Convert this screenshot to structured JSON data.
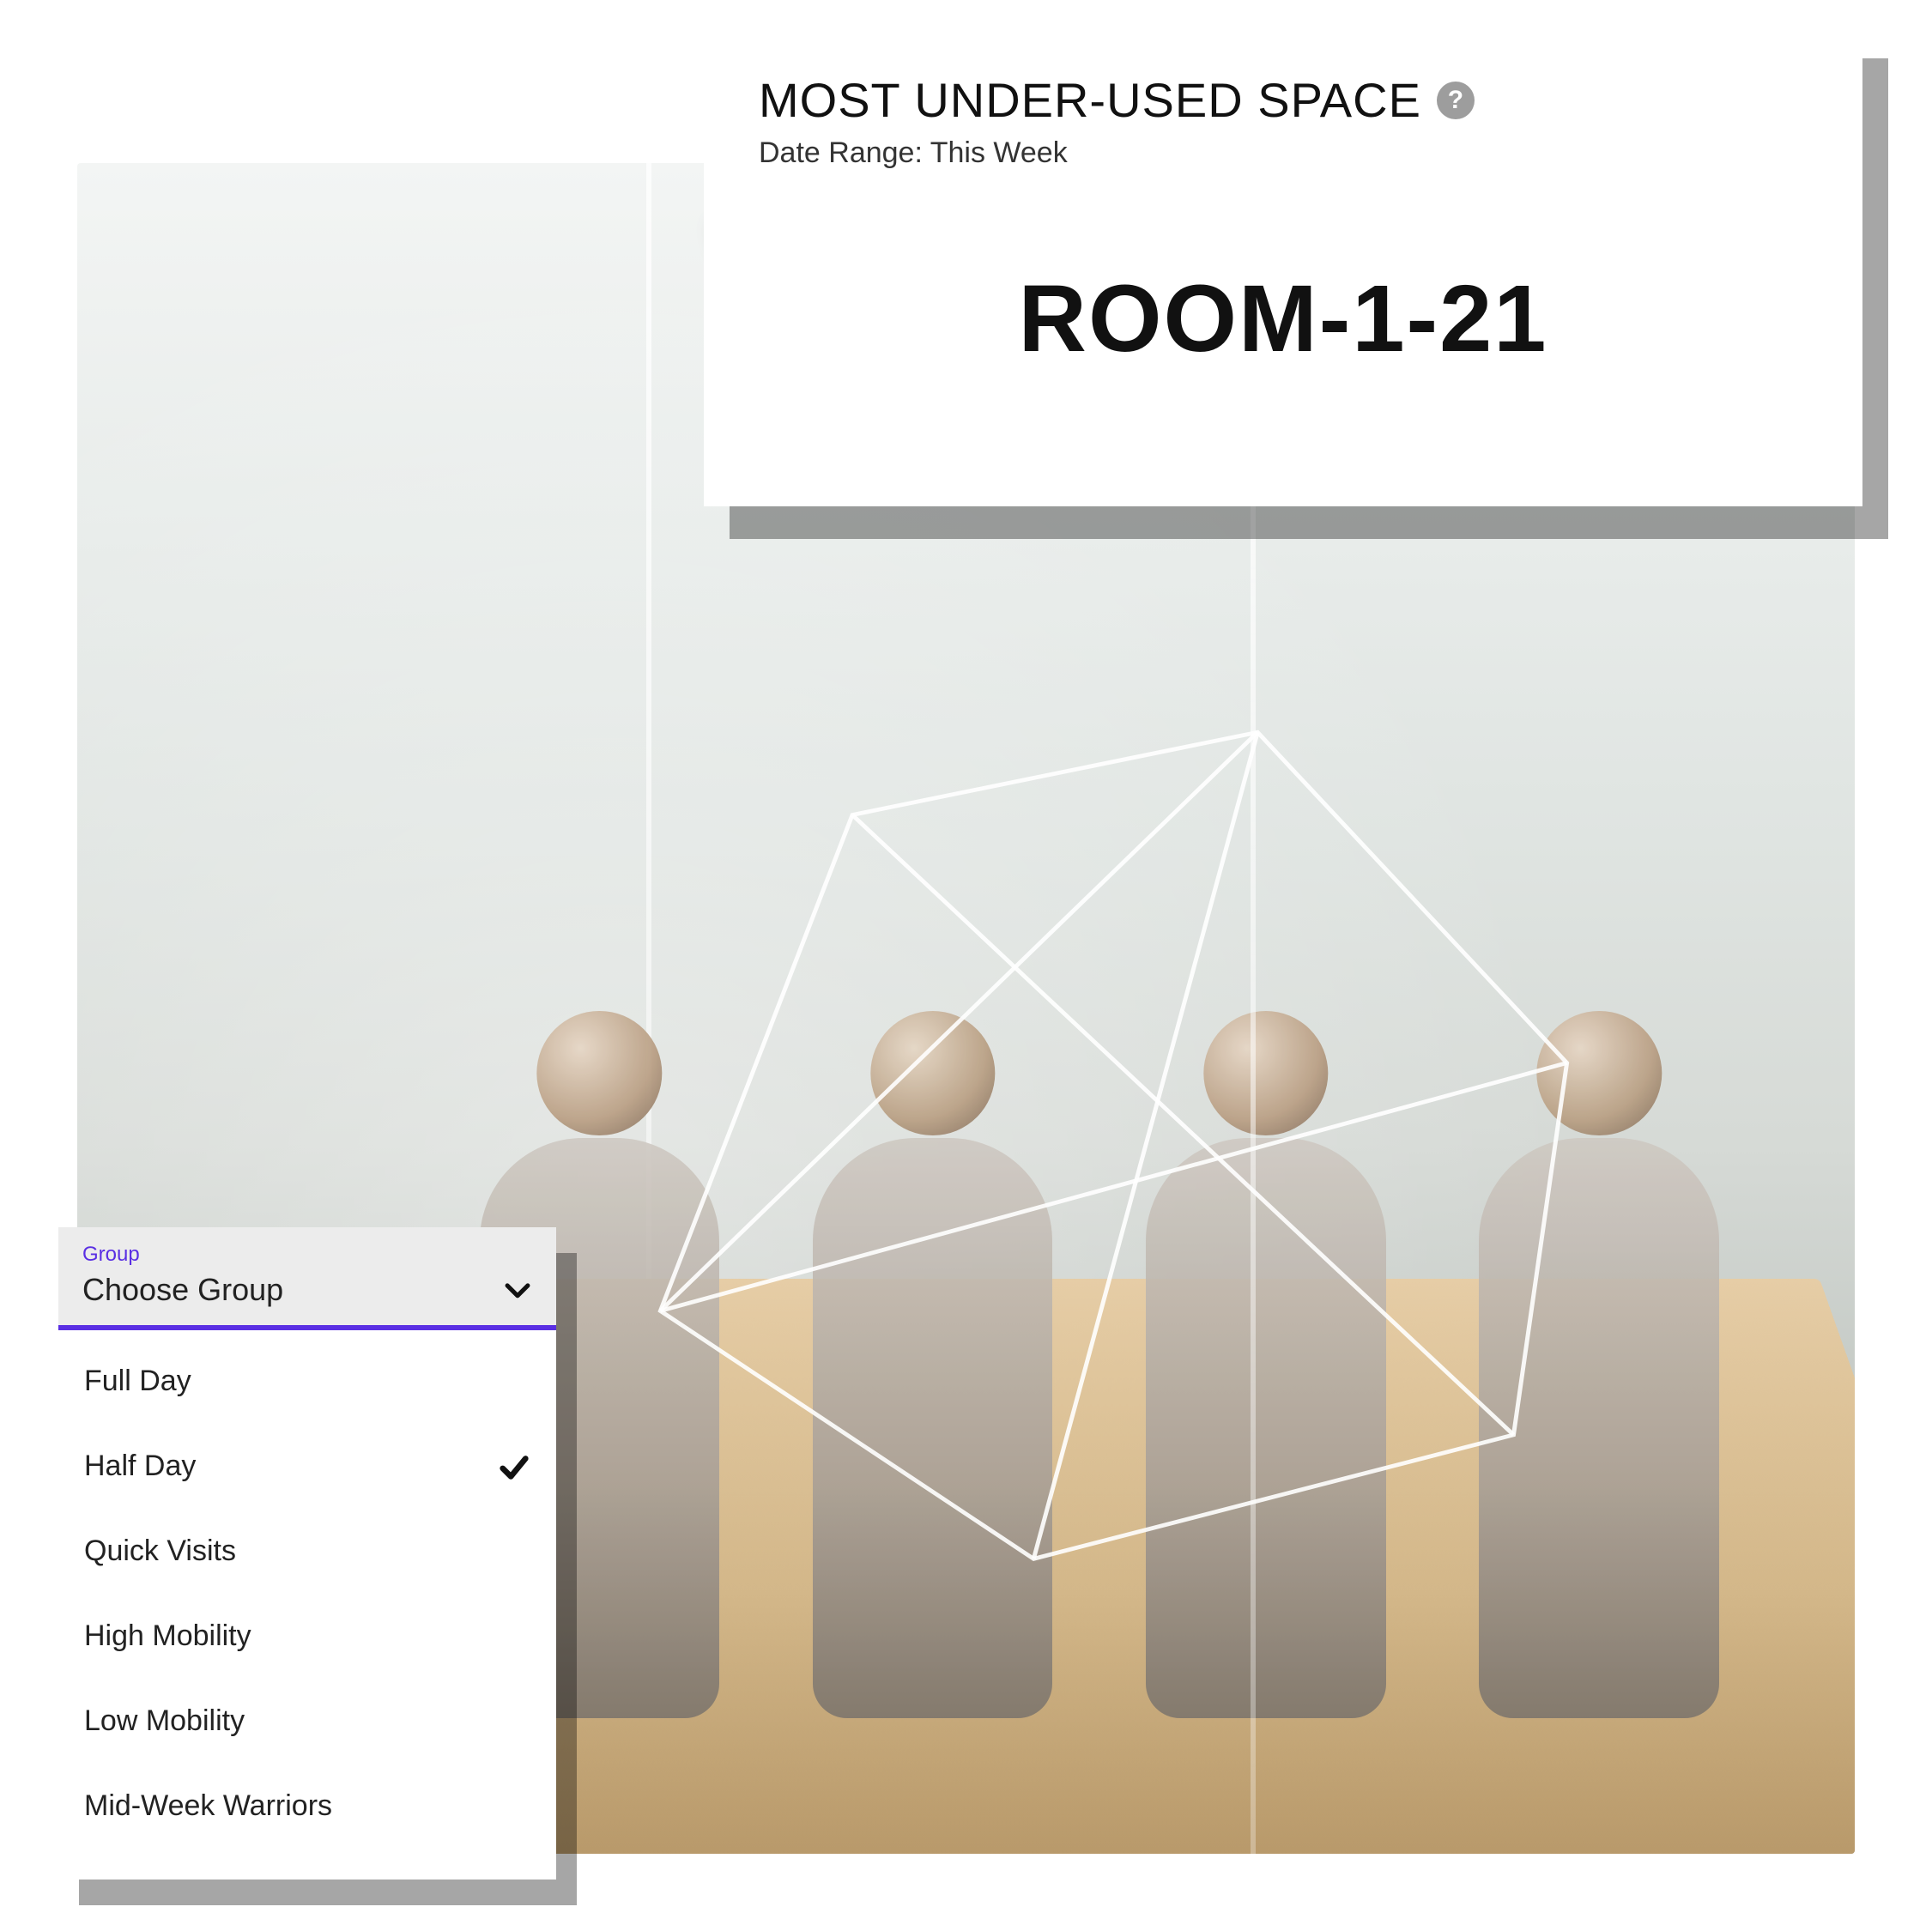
{
  "card_top": {
    "title": "MOST UNDER-USED SPACE",
    "help_icon_glyph": "?",
    "subtitle": "Date Range: This Week",
    "value": "ROOM-1-21"
  },
  "dropdown": {
    "field_label": "Group",
    "selected_label": "Choose Group",
    "options": [
      {
        "label": "Full Day",
        "checked": false
      },
      {
        "label": "Half Day",
        "checked": true
      },
      {
        "label": "Quick Visits",
        "checked": false
      },
      {
        "label": "High Mobility",
        "checked": false
      },
      {
        "label": "Low Mobility",
        "checked": false
      },
      {
        "label": "Mid-Week Warriors",
        "checked": false
      }
    ]
  },
  "colors": {
    "accent_purple": "#5a2fe3",
    "shadow": "rgba(0,0,0,0.35)"
  }
}
